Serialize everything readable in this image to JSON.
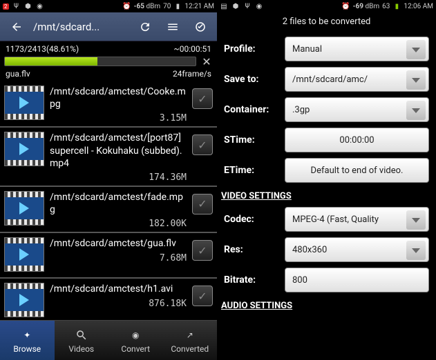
{
  "left": {
    "status": {
      "badge": "2",
      "dbm": "-65",
      "dbm_unit": "dBm",
      "batt": "70",
      "time": "12:21 AM"
    },
    "toolbar_path": "/mnt/sdcard...",
    "progress": {
      "count": "1173/2413(48.61%)",
      "eta": "~00:00:51",
      "file": "gua.flv",
      "rate": "24frame/s"
    },
    "files": [
      {
        "path": "/mnt/sdcard/amctest/Cooke.mpg",
        "size": "3.15M"
      },
      {
        "path": "/mnt/sdcard/amctest/[port87] supercell - Kokuhaku (subbed).mp4",
        "size": "174.36M"
      },
      {
        "path": "/mnt/sdcard/amctest/fade.mpg",
        "size": "182.00K"
      },
      {
        "path": "/mnt/sdcard/amctest/gua.flv",
        "size": "7.68M"
      },
      {
        "path": "/mnt/sdcard/amctest/h1.avi",
        "size": "876.18K"
      }
    ],
    "tabs": [
      "Browse",
      "Videos",
      "Convert",
      "Converted"
    ]
  },
  "right": {
    "status": {
      "dbm": "-69",
      "dbm_unit": "dBm",
      "batt": "63",
      "time": "12:06 AM"
    },
    "header": "2  files to be converted",
    "labels": {
      "profile": "Profile:",
      "saveto": "Save to:",
      "container": "Container:",
      "stime": "STime:",
      "etime": "ETime:",
      "codec": "Codec:",
      "res": "Res:",
      "bitrate": "Bitrate:"
    },
    "values": {
      "profile": "Manual",
      "saveto": "/mnt/sdcard/amc/",
      "container": ".3gp",
      "stime": "00:00:00",
      "etime": "Default to end of video.",
      "codec": "MPEG-4 (Fast, Quality",
      "res": "480x360",
      "bitrate": "800"
    },
    "sections": {
      "video": "VIDEO SETTINGS",
      "audio": "AUDIO SETTINGS"
    }
  }
}
